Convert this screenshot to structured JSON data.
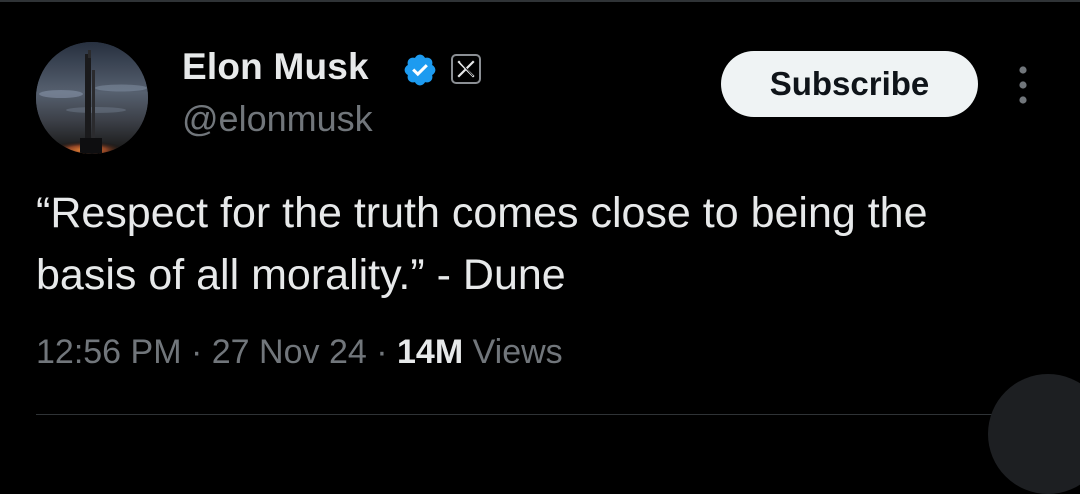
{
  "author": {
    "name": "Elon Musk",
    "handle": "@elonmusk",
    "verified_icon": "verified-badge-icon",
    "affiliate_icon": "x-logo-icon",
    "avatar_icon": "rocket-launch-photo"
  },
  "actions": {
    "subscribe_label": "Subscribe",
    "more_icon": "more-vertical-icon"
  },
  "tweet": {
    "text": "“Respect for the truth comes close to being the basis of all morality.” - Dune"
  },
  "meta": {
    "time": "12:56 PM",
    "separator": "·",
    "date": "27 Nov 24",
    "views_count": "14M",
    "views_label": "Views"
  },
  "colors": {
    "background": "#000000",
    "text_primary": "#e7e9ea",
    "text_secondary": "#71767b",
    "verified_blue": "#1d9bf0",
    "button_bg": "#eff3f4",
    "divider": "#2f3336"
  }
}
